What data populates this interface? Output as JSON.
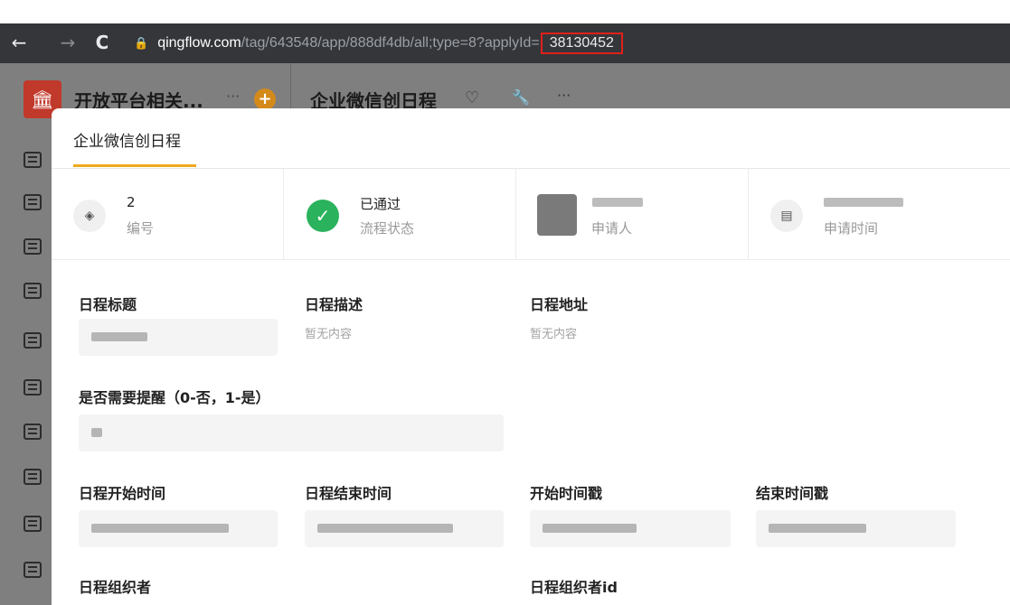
{
  "browser": {
    "back": "←",
    "forward": "→",
    "reload": "C",
    "lock": "🔒",
    "url_domain": "qingflow.com",
    "url_path": "/tag/643548/app/888df4db/all;type=8?applyId=",
    "url_apply_id": "38130452"
  },
  "app": {
    "workspace_name": "开放平台相关...",
    "workspace_more": "···",
    "add_label": "+",
    "app_title": "企业微信创日程",
    "more": "···"
  },
  "modal": {
    "tab_title": "企业微信创日程",
    "info": {
      "number_value": "2",
      "number_label": "编号",
      "status_value": "已通过",
      "status_label": "流程状态",
      "applicant_label": "申请人",
      "time_label": "申请时间"
    },
    "fields": {
      "title_label": "日程标题",
      "desc_label": "日程描述",
      "desc_empty": "暂无内容",
      "addr_label": "日程地址",
      "addr_empty": "暂无内容",
      "remind_label": "是否需要提醒（0-否，1-是）",
      "start_label": "日程开始时间",
      "end_label": "日程结束时间",
      "start_ts_label": "开始时间戳",
      "end_ts_label": "结束时间戳",
      "organizer_label": "日程组织者",
      "organizer_id_label": "日程组织者id"
    }
  },
  "colors": {
    "accent": "#f0a81b",
    "success": "#2ab35c",
    "url_highlight": "#e0201b"
  }
}
